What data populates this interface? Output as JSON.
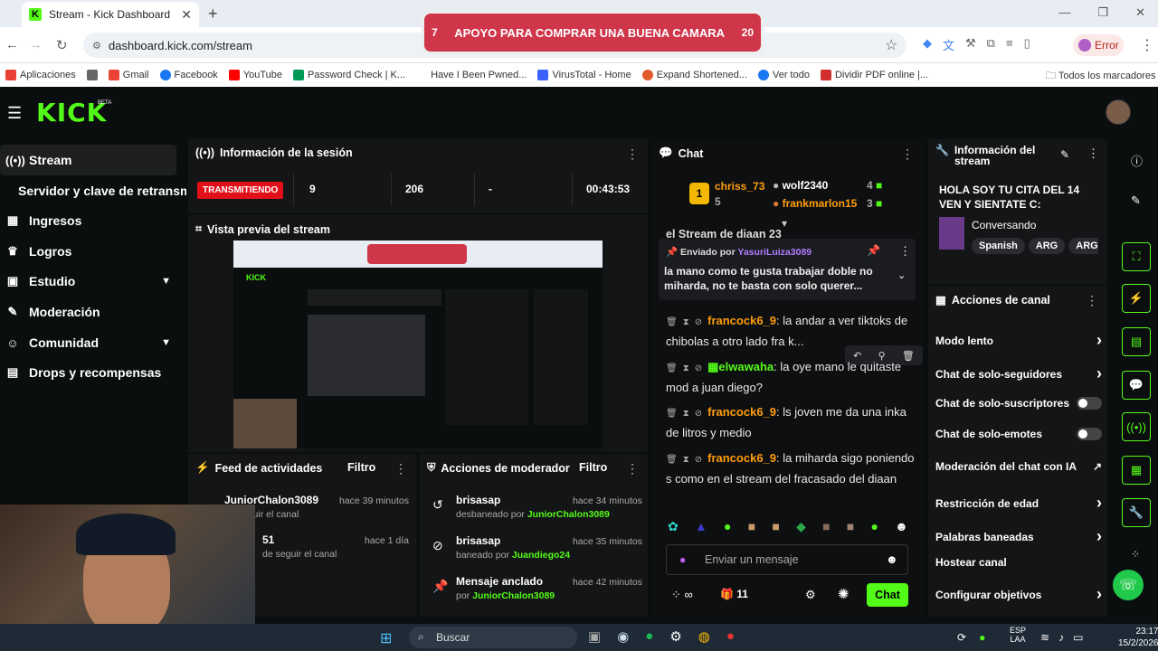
{
  "browser": {
    "tab_title": "Stream - Kick Dashboard",
    "url": "dashboard.kick.com/stream",
    "error_label": "Error",
    "bookmarks": [
      {
        "label": "Aplicaciones",
        "color": "#e94235"
      },
      {
        "label": "",
        "color": "#666"
      },
      {
        "label": "Gmail",
        "color": "#ea4335"
      },
      {
        "label": "Facebook",
        "color": "#1877f2"
      },
      {
        "label": "YouTube",
        "color": "#ff0000"
      },
      {
        "label": "Password Check | K...",
        "color": "#009a57"
      },
      {
        "label": "Have I Been Pwned...",
        "color": "#444"
      },
      {
        "label": "VirusTotal - Home",
        "color": "#3b61ff"
      },
      {
        "label": "Expand Shortened...",
        "color": "#e05c2b"
      },
      {
        "label": "Ver todo",
        "color": "#1877f2"
      },
      {
        "label": "Dividir PDF online |...",
        "color": "#d32f2f"
      }
    ],
    "all_bookmarks": "Todos los marcadores"
  },
  "overlay": {
    "left": "7",
    "title": "APOYO PARA COMPRAR UNA BUENA CAMARA",
    "right": "20"
  },
  "sidebar": {
    "items": [
      {
        "label": "Stream",
        "icon": "((•))"
      },
      {
        "label": "Servidor y clave de retransm",
        "icon": ""
      },
      {
        "label": "Ingresos",
        "icon": "▦"
      },
      {
        "label": "Logros",
        "icon": "🏆"
      },
      {
        "label": "Estudio",
        "icon": "▣"
      },
      {
        "label": "Moderación",
        "icon": "🔧"
      },
      {
        "label": "Comunidad",
        "icon": "👥"
      },
      {
        "label": "Drops y recompensas",
        "icon": "▤"
      }
    ]
  },
  "session": {
    "title": "Información de la sesión",
    "status": "TRANSMITIENDO",
    "viewers": "9",
    "followers": "206",
    "subs": "-",
    "time": "00:43:53"
  },
  "preview": {
    "title": "Vista previa del stream"
  },
  "activity": {
    "title": "Feed de actividades",
    "filter": "Filtro",
    "rows": [
      {
        "name": "JuniorChalon3089",
        "time": "hace 39 minutos",
        "sub": "de seguir el canal"
      },
      {
        "name": "51",
        "time": "hace 1 día",
        "sub": "de seguir el canal"
      }
    ]
  },
  "modactions": {
    "title": "Acciones de moderador",
    "filter": "Filtro",
    "rows": [
      {
        "name": "brisasap",
        "time": "hace 34 minutos",
        "action": "desbaneado por",
        "by": "JuniorChalon3089"
      },
      {
        "name": "brisasap",
        "time": "hace 35 minutos",
        "action": "baneado por",
        "by": "Juandiego24"
      },
      {
        "name": "Mensaje anclado",
        "time": "hace 42 minutos",
        "action": "por",
        "by": "JuniorChalon3089"
      }
    ]
  },
  "chat": {
    "title": "Chat",
    "leader1": {
      "name": "chriss_73",
      "count": "5"
    },
    "leader2": {
      "name": "wolf2340",
      "count": "4"
    },
    "leader3": {
      "name": "frankmarlon15",
      "count": "3"
    },
    "stream_line": "el Stream de diaan 23",
    "pinned": {
      "label": "Enviado por",
      "by": "YasuriLuiza3089",
      "text": "la mano como te gusta trabajar doble no miharda, no te basta con solo querer..."
    },
    "messages": [
      {
        "user": "francock6_9",
        "text": ": la andar a ver tiktoks de chibolas a otro lado fra k..."
      },
      {
        "user": "elwawaha",
        "text": ": la oye mano le quitaste mod a juan diego?"
      },
      {
        "user": "francock6_9",
        "text": ": ls joven me da una inka de litros y medio"
      },
      {
        "user": "francock6_9",
        "text": ": la miharda sigo poniendo s como en el stream del fracasado del diaan"
      }
    ],
    "input_placeholder": "Enviar un mensaje",
    "count": "11",
    "send": "Chat"
  },
  "streaminfo": {
    "title": "Información del stream",
    "headline": "HOLA SOY TU CITA DEL 14 VEN Y SIENTATE C:",
    "category": "Conversando",
    "tags": [
      "Spanish",
      "ARG",
      "ARG"
    ]
  },
  "channel": {
    "title": "Acciones de canal",
    "items": [
      {
        "label": "Modo lento",
        "ctl": "›"
      },
      {
        "label": "Chat de solo-seguidores",
        "ctl": "›"
      },
      {
        "label": "Chat de solo-suscriptores",
        "ctl": "toggle"
      },
      {
        "label": "Chat de solo-emotes",
        "ctl": "toggle"
      },
      {
        "label": "Moderación del chat con IA",
        "ctl": "↗"
      },
      {
        "label": "Restricción de edad",
        "ctl": "›"
      },
      {
        "label": "Palabras baneadas",
        "ctl": "›"
      },
      {
        "label": "Hostear canal",
        "ctl": ""
      },
      {
        "label": "Configurar objetivos",
        "ctl": "›"
      }
    ]
  },
  "taskbar": {
    "search": "Buscar",
    "lang": "ESP",
    "lang2": "LAA",
    "time": "23:17",
    "date": "15/2/2026"
  }
}
